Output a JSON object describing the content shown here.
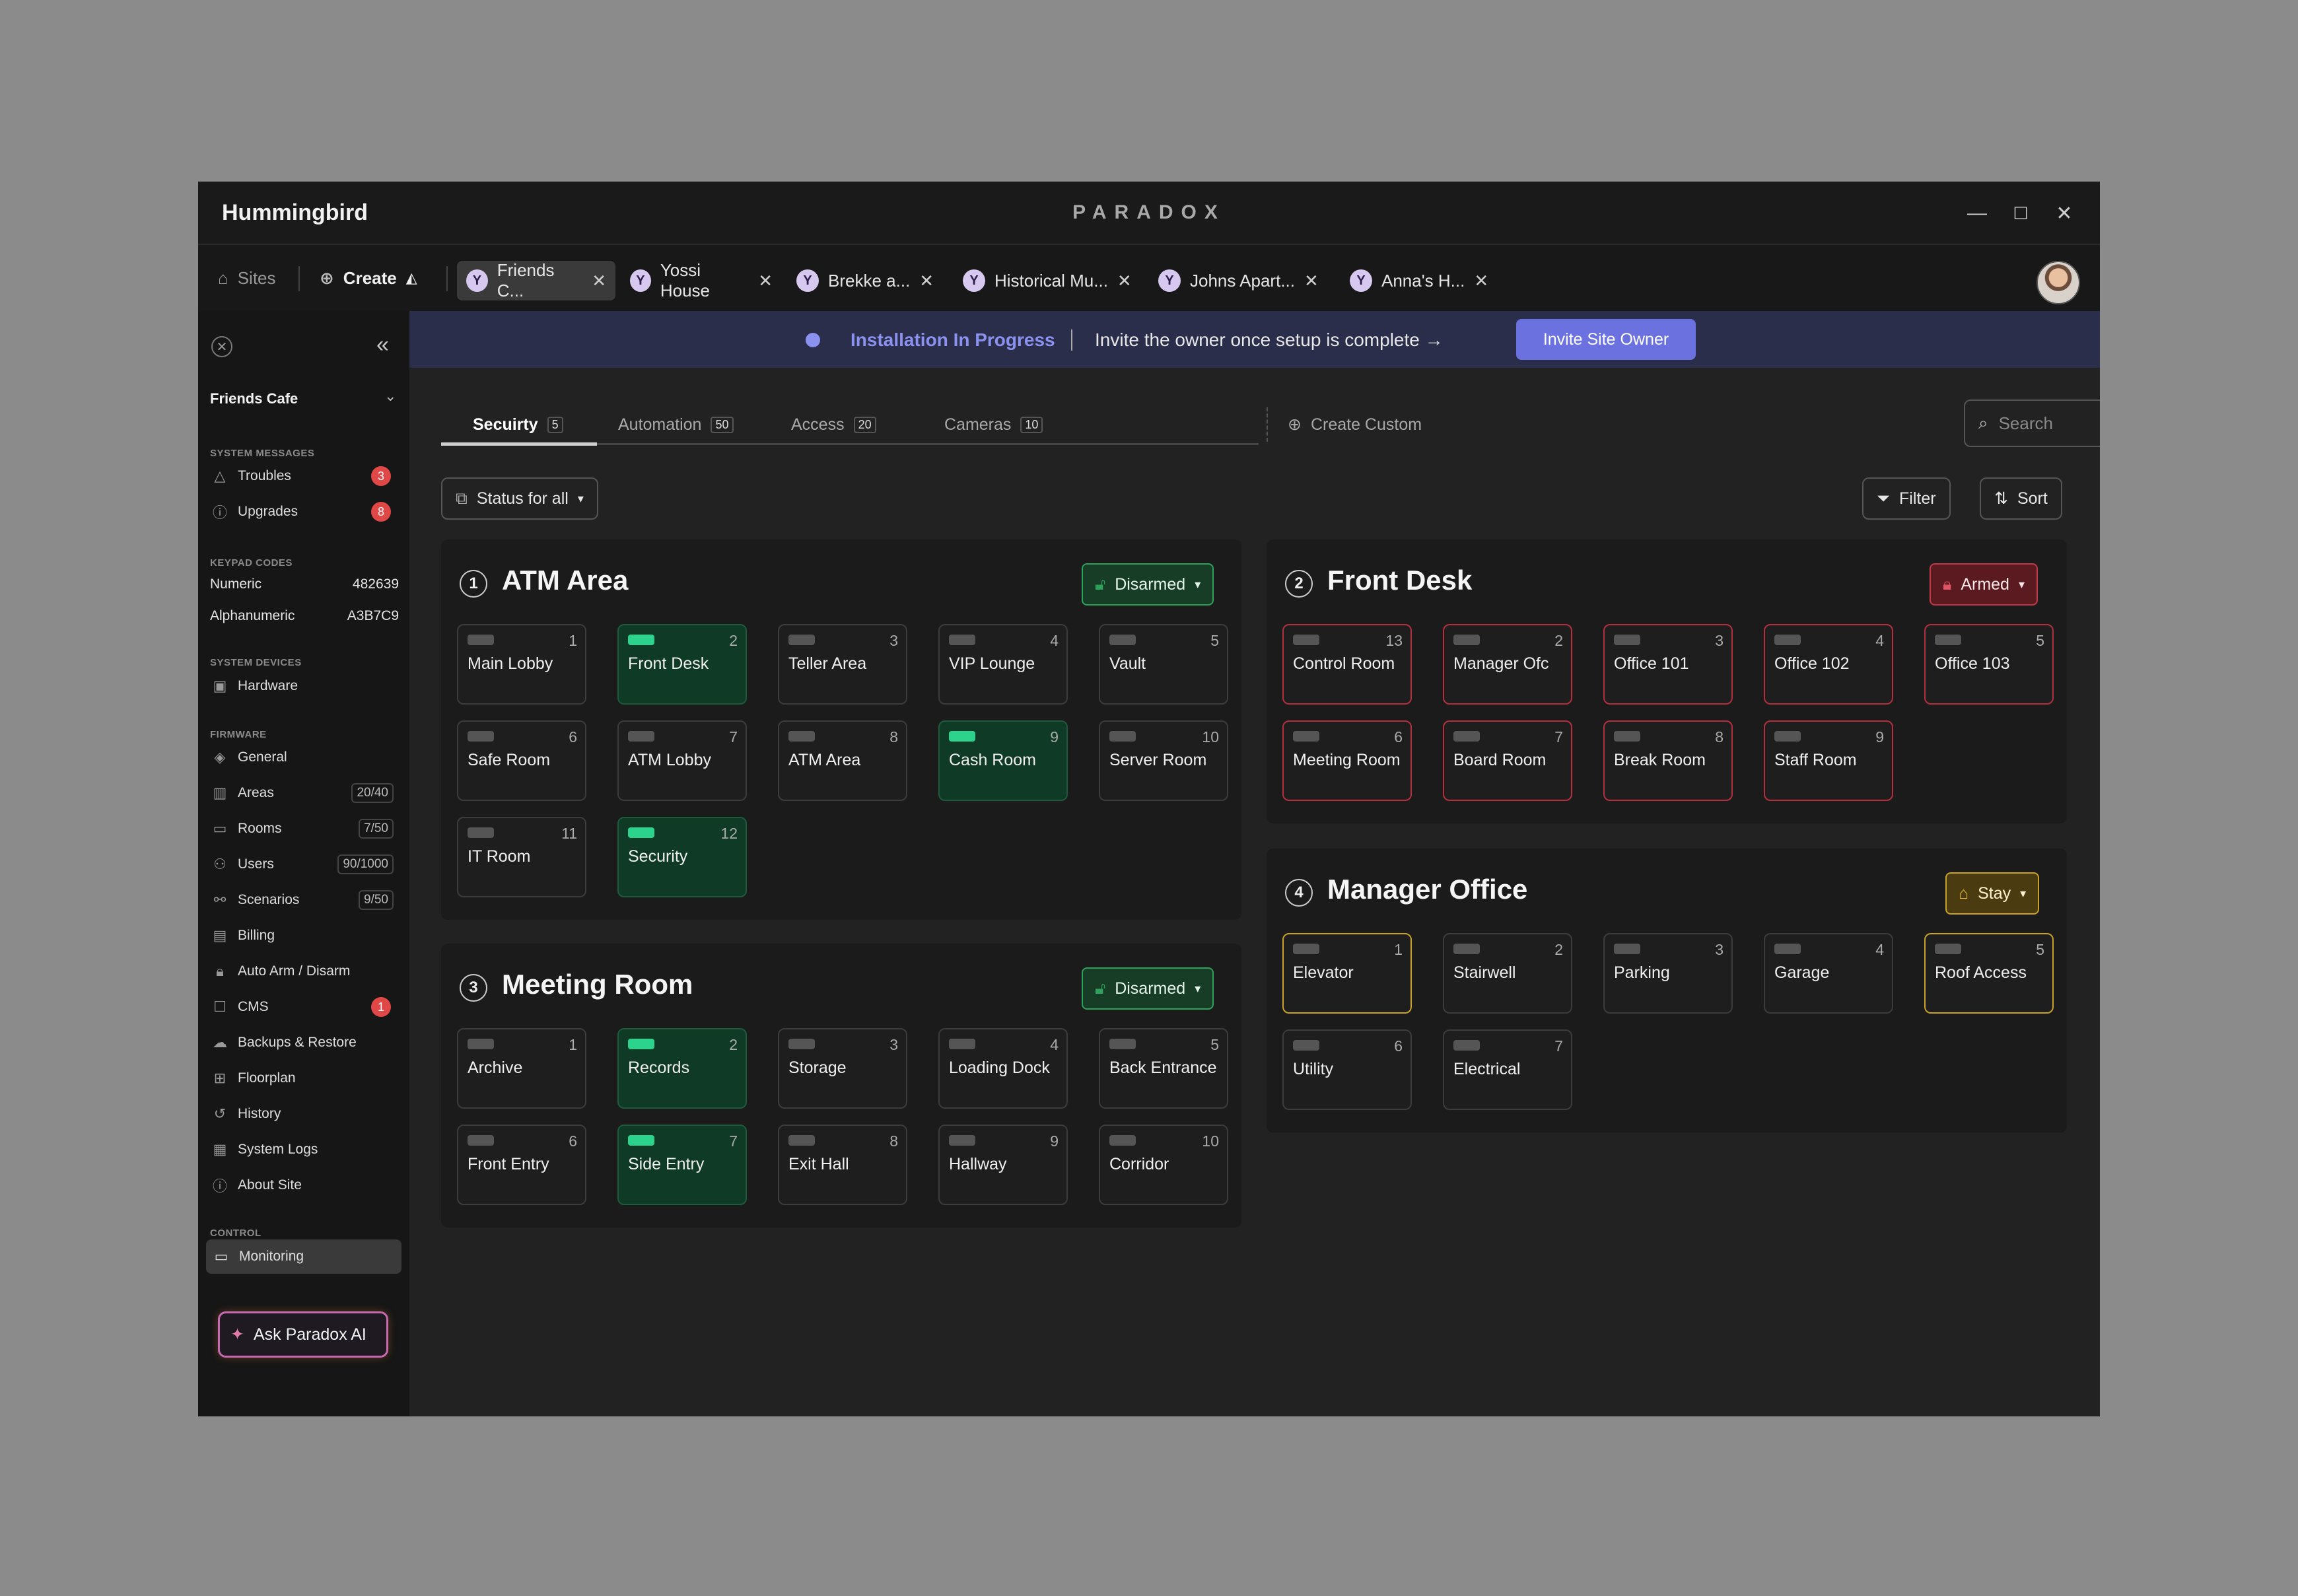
{
  "app": {
    "title": "Hummingbird",
    "brand": "PARADOX"
  },
  "window_controls": {
    "minimize": "—",
    "maximize": "☐",
    "close": "✕"
  },
  "topbar": {
    "sites_label": "Sites",
    "create_label": "Create",
    "tabs": [
      {
        "label": "Friends C...",
        "tag": "Y",
        "active": true
      },
      {
        "label": "Yossi House",
        "tag": "Y"
      },
      {
        "label": "Brekke a...",
        "tag": "Y"
      },
      {
        "label": "Historical Mu...",
        "tag": "Y"
      },
      {
        "label": "Johns Apart...",
        "tag": "Y"
      },
      {
        "label": "Anna's H...",
        "tag": "Y"
      }
    ]
  },
  "sidebar": {
    "site_name": "Friends Cafe",
    "sections": {
      "system_messages": "SYSTEM MESSAGES",
      "keypad_codes": "KEYPAD CODES",
      "system_devices": "SYSTEM DEVICES",
      "firmware": "FIRMWARE",
      "control": "CONTROL"
    },
    "troubles": {
      "label": "Troubles",
      "badge": "3"
    },
    "upgrades": {
      "label": "Upgrades",
      "badge": "8"
    },
    "numeric": {
      "label": "Numeric",
      "value": "482639"
    },
    "alphanumeric": {
      "label": "Alphanumeric",
      "value": "A3B7C9"
    },
    "hardware": "Hardware",
    "firmware_items": [
      {
        "label": "General",
        "icon": "cube-icon"
      },
      {
        "label": "Areas",
        "count": "20/40",
        "icon": "areas-icon"
      },
      {
        "label": "Rooms",
        "count": "7/50",
        "icon": "rooms-icon"
      },
      {
        "label": "Users",
        "count": "90/1000",
        "icon": "users-icon"
      },
      {
        "label": "Scenarios",
        "count": "9/50",
        "icon": "scenarios-icon"
      },
      {
        "label": "Billing",
        "icon": "billing-icon"
      },
      {
        "label": "Auto Arm / Disarm",
        "icon": "lock-icon"
      },
      {
        "label": "CMS",
        "badge": "1",
        "icon": "cms-icon"
      },
      {
        "label": "Backups & Restore",
        "icon": "cloud-icon"
      },
      {
        "label": "Floorplan",
        "icon": "floorplan-icon"
      },
      {
        "label": "History",
        "icon": "history-icon"
      },
      {
        "label": "System Logs",
        "icon": "logs-icon"
      },
      {
        "label": "About Site",
        "icon": "info-icon"
      }
    ],
    "monitoring": "Monitoring",
    "ask_ai": "Ask Paradox AI"
  },
  "banner": {
    "status": "Installation In Progress",
    "message": "Invite the owner once setup is complete →",
    "button": "Invite Site Owner"
  },
  "category_tabs": [
    {
      "label": "Secuirty",
      "count": "5",
      "active": true
    },
    {
      "label": "Automation",
      "count": "50"
    },
    {
      "label": "Access",
      "count": "20"
    },
    {
      "label": "Cameras",
      "count": "10"
    }
  ],
  "create_custom": "Create Custom",
  "search": {
    "placeholder": "Search"
  },
  "toolbar": {
    "status_all": "Status for all",
    "filter": "Filter",
    "sort": "Sort"
  },
  "areas": [
    {
      "number": "1",
      "name": "ATM Area",
      "state": "Disarmed",
      "state_kind": "disarmed",
      "zones": [
        {
          "num": "1",
          "name": "Main Lobby"
        },
        {
          "num": "2",
          "name": "Front Desk",
          "on": true
        },
        {
          "num": "3",
          "name": "Teller Area"
        },
        {
          "num": "4",
          "name": "VIP Lounge"
        },
        {
          "num": "5",
          "name": "Vault"
        },
        {
          "num": "6",
          "name": "Safe Room"
        },
        {
          "num": "7",
          "name": "ATM Lobby"
        },
        {
          "num": "8",
          "name": "ATM Area"
        },
        {
          "num": "9",
          "name": "Cash Room",
          "on": true
        },
        {
          "num": "10",
          "name": "Server Room"
        },
        {
          "num": "11",
          "name": "IT Room"
        },
        {
          "num": "12",
          "name": "Security",
          "on": true
        }
      ]
    },
    {
      "number": "2",
      "name": "Front Desk",
      "state": "Armed",
      "state_kind": "armed",
      "zones": [
        {
          "num": "13",
          "name": "Control Room"
        },
        {
          "num": "2",
          "name": "Manager Ofc"
        },
        {
          "num": "3",
          "name": "Office 101"
        },
        {
          "num": "4",
          "name": "Office 102"
        },
        {
          "num": "5",
          "name": "Office 103"
        },
        {
          "num": "6",
          "name": "Meeting Room"
        },
        {
          "num": "7",
          "name": "Board Room"
        },
        {
          "num": "8",
          "name": "Break Room"
        },
        {
          "num": "9",
          "name": "Staff Room"
        }
      ]
    },
    {
      "number": "3",
      "name": "Meeting Room",
      "state": "Disarmed",
      "state_kind": "disarmed",
      "zones": [
        {
          "num": "1",
          "name": "Archive"
        },
        {
          "num": "2",
          "name": "Records",
          "on": true
        },
        {
          "num": "3",
          "name": "Storage"
        },
        {
          "num": "4",
          "name": "Loading Dock"
        },
        {
          "num": "5",
          "name": "Back Entrance"
        },
        {
          "num": "6",
          "name": "Front Entry"
        },
        {
          "num": "7",
          "name": "Side Entry",
          "on": true
        },
        {
          "num": "8",
          "name": "Exit Hall"
        },
        {
          "num": "9",
          "name": "Hallway"
        },
        {
          "num": "10",
          "name": "Corridor"
        }
      ]
    },
    {
      "number": "4",
      "name": "Manager Office",
      "state": "Stay",
      "state_kind": "stay",
      "zones": [
        {
          "num": "1",
          "name": "Elevator",
          "warn": true
        },
        {
          "num": "2",
          "name": "Stairwell"
        },
        {
          "num": "3",
          "name": "Parking"
        },
        {
          "num": "4",
          "name": "Garage"
        },
        {
          "num": "5",
          "name": "Roof Access",
          "warn": true
        },
        {
          "num": "6",
          "name": "Utility"
        },
        {
          "num": "7",
          "name": "Electrical"
        }
      ]
    }
  ]
}
